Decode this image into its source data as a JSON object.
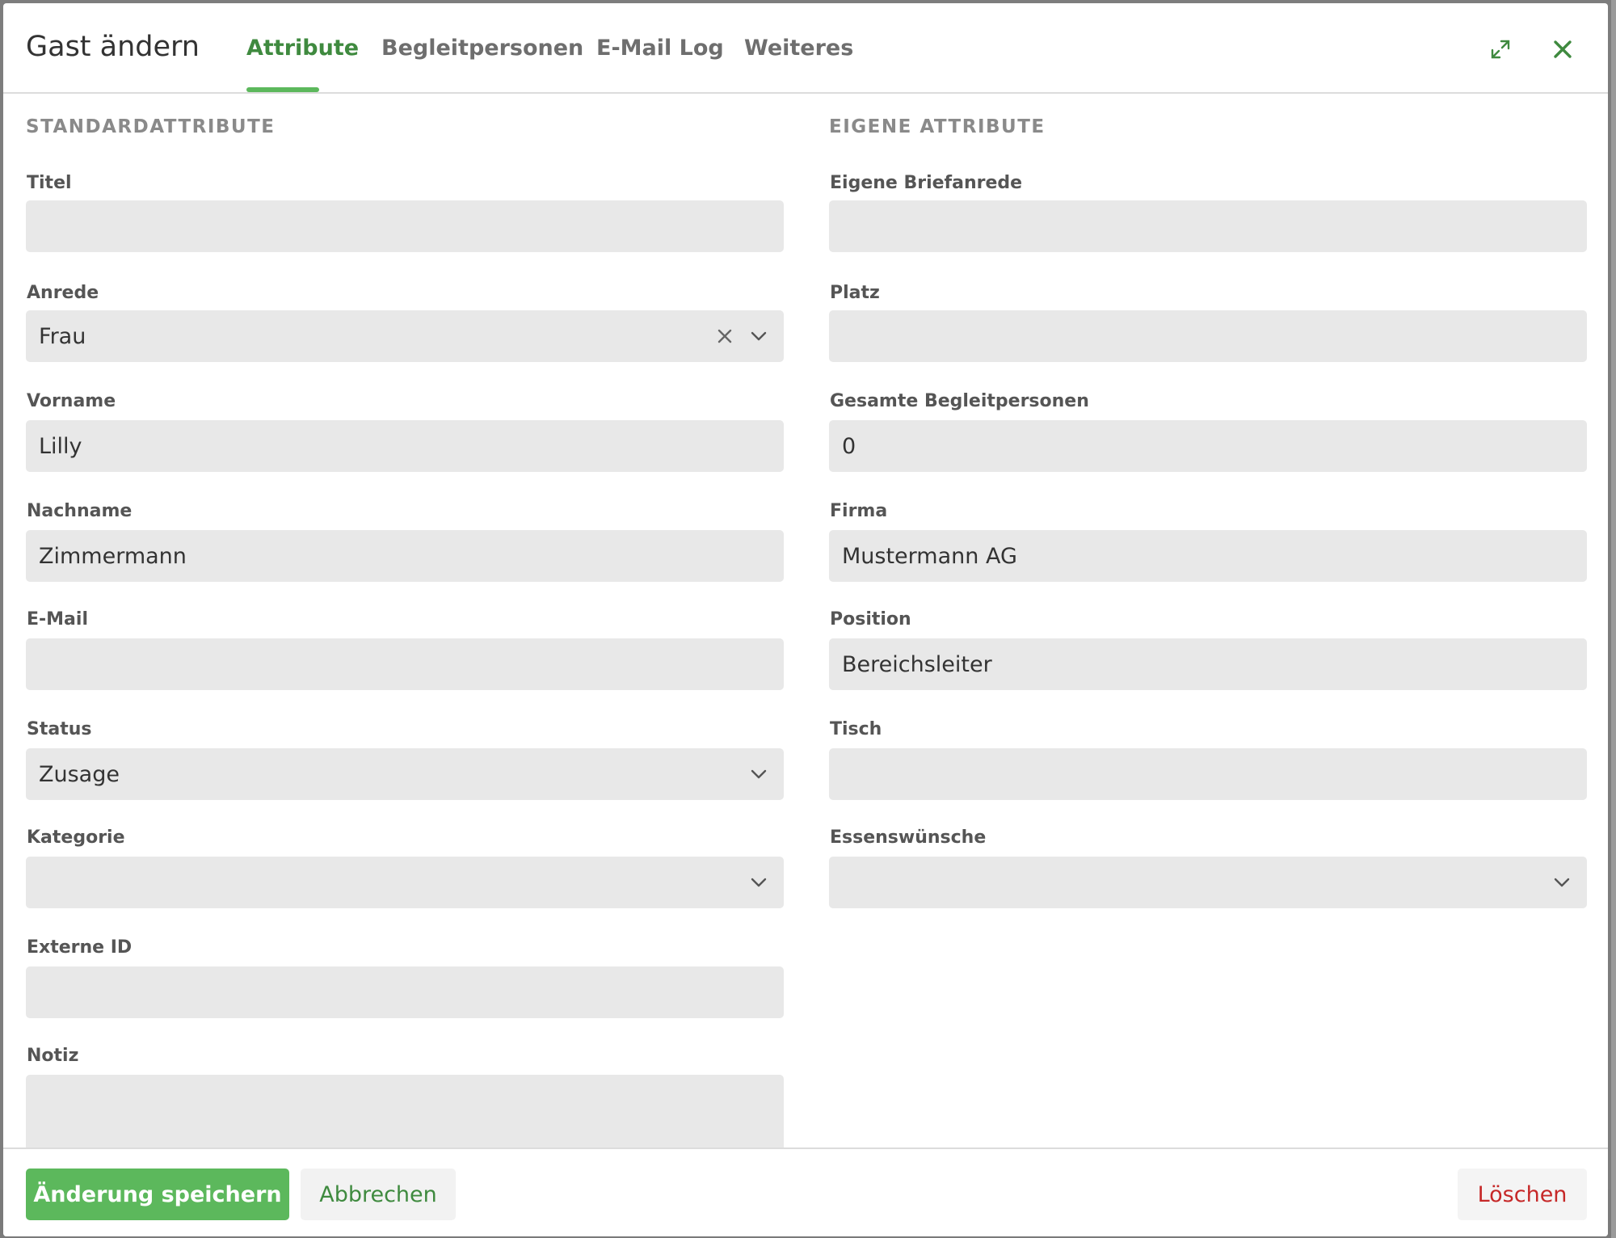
{
  "modal": {
    "title": "Gast ändern",
    "tabs": [
      {
        "label": "Attribute",
        "active": true
      },
      {
        "label": "Begleitpersonen",
        "active": false
      },
      {
        "label": "E-Mail Log",
        "active": false
      },
      {
        "label": "Weiteres",
        "active": false
      }
    ],
    "icons": {
      "expand": "expand-icon",
      "close": "close-icon"
    }
  },
  "left": {
    "section_title": "STANDARDATTRIBUTE",
    "fields": [
      {
        "label": "Titel",
        "value": ""
      },
      {
        "label": "Anrede",
        "value": "Frau"
      },
      {
        "label": "Vorname",
        "value": "Lilly"
      },
      {
        "label": "Nachname",
        "value": "Zimmermann"
      },
      {
        "label": "E-Mail",
        "value": ""
      },
      {
        "label": "Status",
        "value": "Zusage"
      },
      {
        "label": "Kategorie",
        "value": ""
      },
      {
        "label": "Externe ID",
        "value": ""
      },
      {
        "label": "Notiz",
        "value": ""
      }
    ]
  },
  "right": {
    "section_title": "EIGENE ATTRIBUTE",
    "fields": [
      {
        "label": "Eigene Briefanrede",
        "value": ""
      },
      {
        "label": "Platz",
        "value": ""
      },
      {
        "label": "Gesamte Begleitpersonen",
        "value": "0"
      },
      {
        "label": "Firma",
        "value": "Mustermann AG"
      },
      {
        "label": "Position",
        "value": "Bereichsleiter"
      },
      {
        "label": "Tisch",
        "value": ""
      },
      {
        "label": "Essenswünsche",
        "value": ""
      }
    ]
  },
  "footer": {
    "save_label": "Änderung speichern",
    "cancel_label": "Abbrechen",
    "delete_label": "Löschen"
  },
  "colors": {
    "accent": "#5cb85c",
    "accent_text": "#3f8a3f",
    "danger": "#c62828",
    "field_bg": "#e8e8e8"
  }
}
